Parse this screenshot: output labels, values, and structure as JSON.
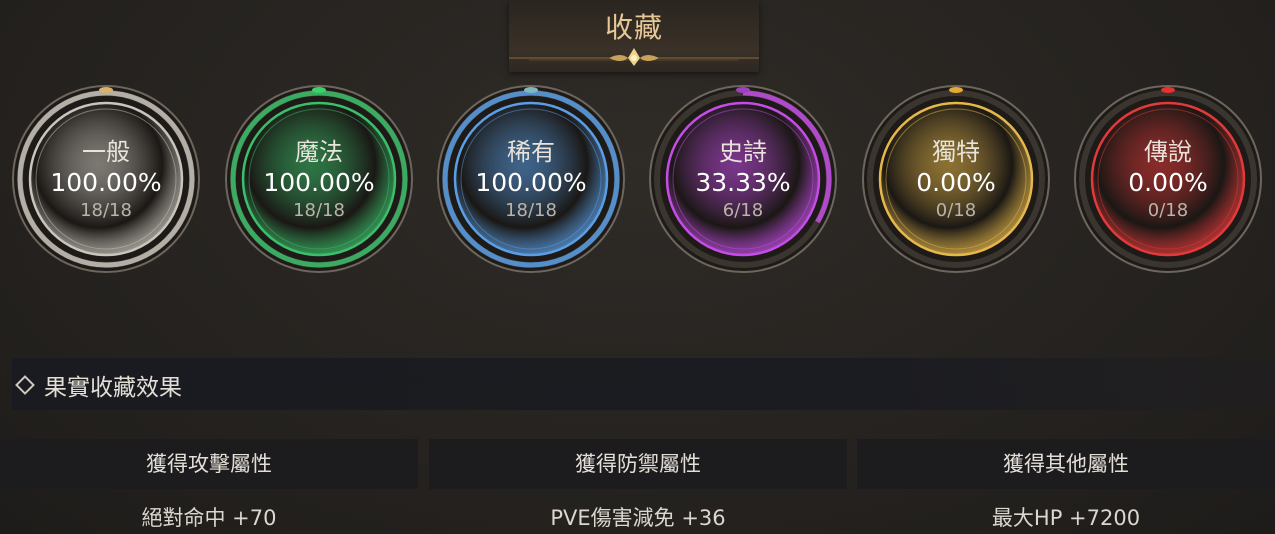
{
  "header": {
    "title": "收藏"
  },
  "rarities": [
    {
      "name": "一般",
      "percent": "100.00%",
      "count": "18/18",
      "progress": 1.0,
      "color": "#c9c4bc",
      "dot": "#d9b36a"
    },
    {
      "name": "魔法",
      "percent": "100.00%",
      "count": "18/18",
      "progress": 1.0,
      "color": "#3bbf6a",
      "dot": "#3bd26a"
    },
    {
      "name": "稀有",
      "percent": "100.00%",
      "count": "18/18",
      "progress": 1.0,
      "color": "#5a9fe6",
      "dot": "#7fb8c0"
    },
    {
      "name": "史詩",
      "percent": "33.33%",
      "count": "6/18",
      "progress": 0.3333,
      "color": "#c44de6",
      "dot": "#a040c0"
    },
    {
      "name": "獨特",
      "percent": "0.00%",
      "count": "0/18",
      "progress": 0.0,
      "color": "#e6b84a",
      "dot": "#e6a830"
    },
    {
      "name": "傳說",
      "percent": "0.00%",
      "count": "0/18",
      "progress": 0.0,
      "color": "#e23a3a",
      "dot": "#e83030"
    }
  ],
  "effects": {
    "title": "果實收藏效果",
    "columns": [
      {
        "header": "獲得攻擊屬性",
        "value": "絕對命中  +70"
      },
      {
        "header": "獲得防禦屬性",
        "value": "PVE傷害減免  +36"
      },
      {
        "header": "獲得其他屬性",
        "value": "最大HP  +7200"
      }
    ]
  },
  "icons": {
    "section_marker": "diamond-icon",
    "title_ornament": "ornament-icon"
  }
}
